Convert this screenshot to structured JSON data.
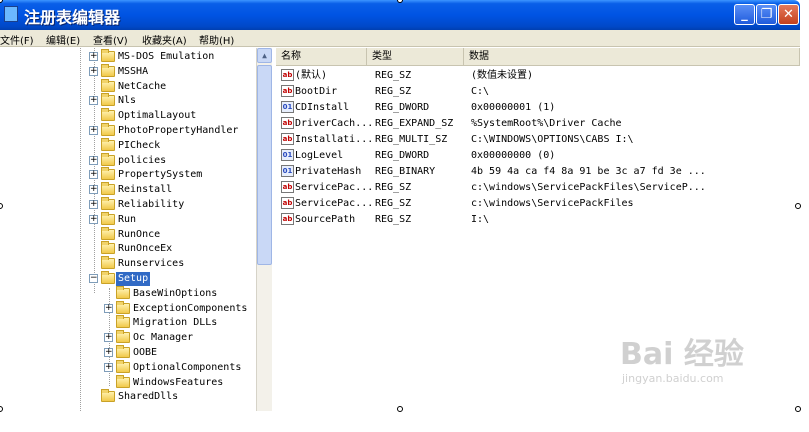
{
  "window": {
    "title": "注册表编辑器",
    "minimize_glyph": "_",
    "maximize_glyph": "❐",
    "close_glyph": "✕"
  },
  "menu": [
    "文件(F)",
    "编辑(E)",
    "查看(V)",
    "收藏夹(A)",
    "帮助(H)"
  ],
  "tree": {
    "items": [
      {
        "label": "MS-DOS Emulation",
        "expander": "+"
      },
      {
        "label": "MSSHA",
        "expander": "+"
      },
      {
        "label": "NetCache",
        "expander": ""
      },
      {
        "label": "Nls",
        "expander": "+"
      },
      {
        "label": "OptimalLayout",
        "expander": ""
      },
      {
        "label": "PhotoPropertyHandler",
        "expander": "+"
      },
      {
        "label": "PICheck",
        "expander": ""
      },
      {
        "label": "policies",
        "expander": "+"
      },
      {
        "label": "PropertySystem",
        "expander": "+"
      },
      {
        "label": "Reinstall",
        "expander": "+"
      },
      {
        "label": "Reliability",
        "expander": "+"
      },
      {
        "label": "Run",
        "expander": "+"
      },
      {
        "label": "RunOnce",
        "expander": ""
      },
      {
        "label": "RunOnceEx",
        "expander": ""
      },
      {
        "label": "Runservices",
        "expander": ""
      },
      {
        "label": "Setup",
        "expander": "−",
        "selected": true
      },
      {
        "label": "BaseWinOptions",
        "expander": ""
      },
      {
        "label": "ExceptionComponents",
        "expander": "+"
      },
      {
        "label": "Migration DLLs",
        "expander": ""
      },
      {
        "label": "Oc Manager",
        "expander": "+"
      },
      {
        "label": "OOBE",
        "expander": "+"
      },
      {
        "label": "OptionalComponents",
        "expander": "+"
      },
      {
        "label": "WindowsFeatures",
        "expander": ""
      },
      {
        "label": "SharedDlls",
        "expander": ""
      }
    ]
  },
  "list": {
    "columns": [
      "名称",
      "类型",
      "数据"
    ],
    "rows": [
      {
        "icon": "ab",
        "name": "(默认)",
        "type": "REG_SZ",
        "data": "(数值未设置)"
      },
      {
        "icon": "ab",
        "name": "BootDir",
        "type": "REG_SZ",
        "data": "C:\\"
      },
      {
        "icon": "01",
        "name": "CDInstall",
        "type": "REG_DWORD",
        "data": "0x00000001 (1)"
      },
      {
        "icon": "ab",
        "name": "DriverCach...",
        "type": "REG_EXPAND_SZ",
        "data": "%SystemRoot%\\Driver Cache"
      },
      {
        "icon": "ab",
        "name": "Installati...",
        "type": "REG_MULTI_SZ",
        "data": "C:\\WINDOWS\\OPTIONS\\CABS I:\\"
      },
      {
        "icon": "01",
        "name": "LogLevel",
        "type": "REG_DWORD",
        "data": "0x00000000 (0)"
      },
      {
        "icon": "01",
        "name": "PrivateHash",
        "type": "REG_BINARY",
        "data": "4b 59 4a ca f4 8a 91 be 3c a7 fd 3e ..."
      },
      {
        "icon": "ab",
        "name": "ServicePac...",
        "type": "REG_SZ",
        "data": "c:\\windows\\ServicePackFiles\\ServiceP..."
      },
      {
        "icon": "ab",
        "name": "ServicePac...",
        "type": "REG_SZ",
        "data": "c:\\windows\\ServicePackFiles"
      },
      {
        "icon": "ab",
        "name": "SourcePath",
        "type": "REG_SZ",
        "data": "I:\\"
      }
    ]
  },
  "watermark": {
    "main": "Bai 经验",
    "sub": "jingyan.baidu.com"
  }
}
